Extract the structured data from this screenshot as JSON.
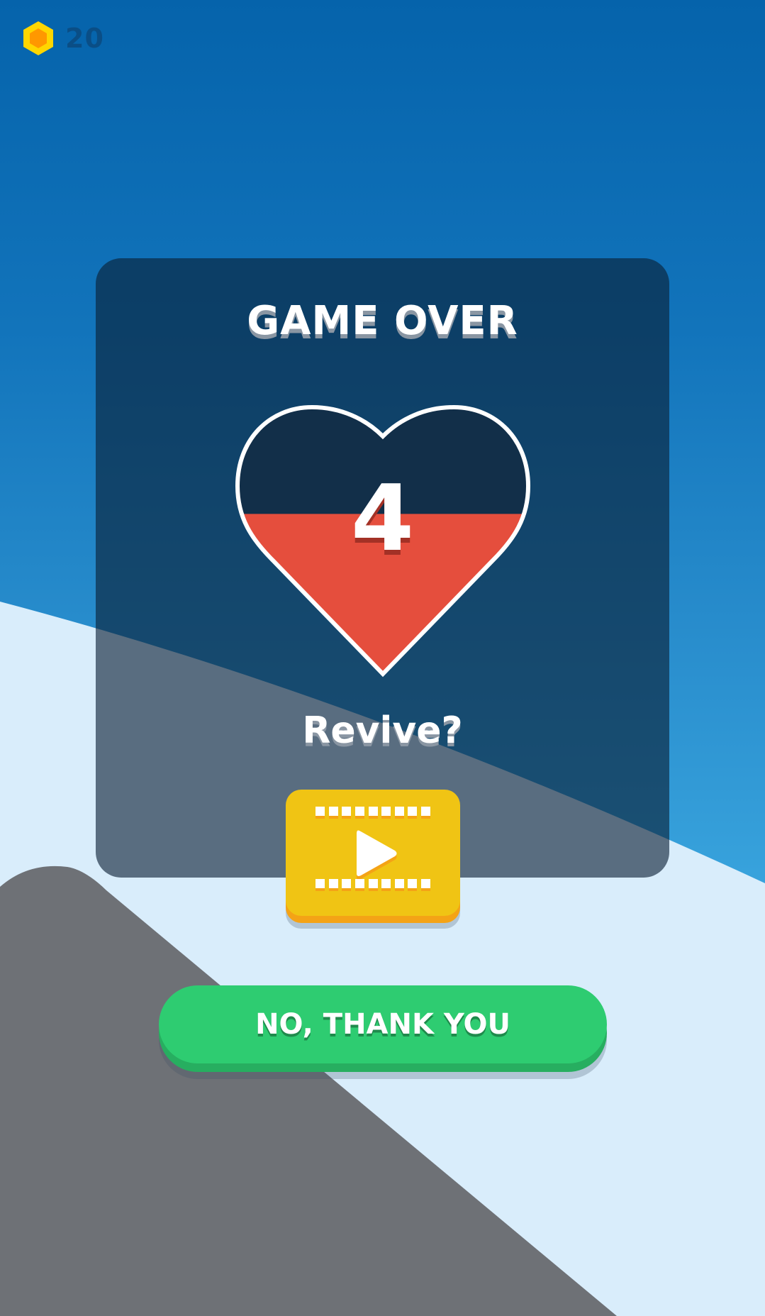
{
  "hud": {
    "coin_icon": "hexagon-coin-icon",
    "coin_count": "20",
    "coin_color": "#ffc107"
  },
  "game_over": {
    "title": "GAME OVER",
    "lives_remaining": "4",
    "heart_icon": "heart-icon",
    "heart_fill_fraction": 0.6,
    "heart_fill_color": "#e54e3d",
    "revive_prompt": "Revive?"
  },
  "actions": {
    "watch_video_icon": "play-video-icon",
    "watch_video_color": "#f0c414",
    "no_thanks_label": "NO, THANK YOU",
    "no_thanks_color": "#2ecc71"
  }
}
